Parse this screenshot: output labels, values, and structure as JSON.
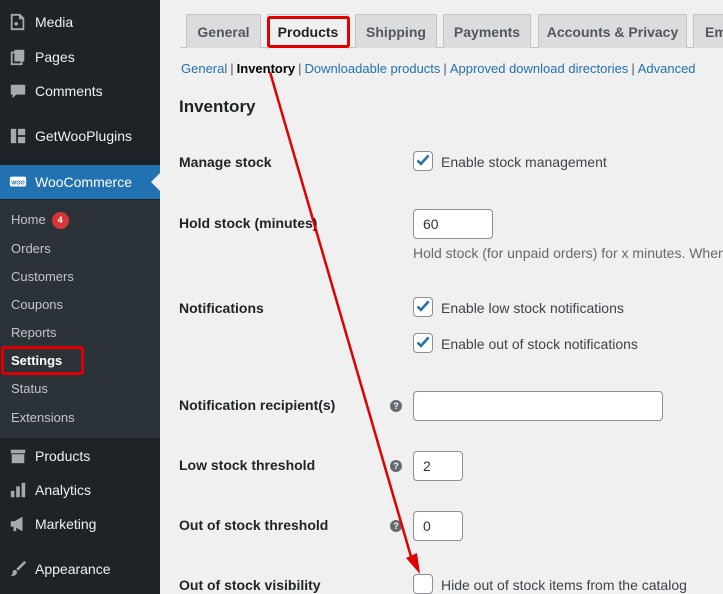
{
  "sidebar": {
    "items": [
      {
        "label": "Media",
        "icon": "media-icon"
      },
      {
        "label": "Pages",
        "icon": "pages-icon"
      },
      {
        "label": "Comments",
        "icon": "comments-icon"
      },
      {
        "label": "GetWooPlugins",
        "icon": "plugin-icon"
      },
      {
        "label": "WooCommerce",
        "icon": "woo-icon"
      },
      {
        "label": "Products",
        "icon": "archive-icon"
      },
      {
        "label": "Analytics",
        "icon": "chart-icon"
      },
      {
        "label": "Marketing",
        "icon": "megaphone-icon"
      },
      {
        "label": "Appearance",
        "icon": "brush-icon"
      }
    ],
    "woo_badge": "WOO",
    "submenu": [
      {
        "label": "Home",
        "badge": "4"
      },
      {
        "label": "Orders"
      },
      {
        "label": "Customers"
      },
      {
        "label": "Coupons"
      },
      {
        "label": "Reports"
      },
      {
        "label": "Settings"
      },
      {
        "label": "Status"
      },
      {
        "label": "Extensions"
      }
    ]
  },
  "tabs": [
    "General",
    "Products",
    "Shipping",
    "Payments",
    "Accounts & Privacy",
    "Em"
  ],
  "subnav": [
    "General",
    "Inventory",
    "Downloadable products",
    "Approved download directories",
    "Advanced"
  ],
  "section_title": "Inventory",
  "fields": {
    "manage_stock": {
      "label": "Manage stock",
      "checkbox": "Enable stock management",
      "checked": true
    },
    "hold_stock": {
      "label": "Hold stock (minutes)",
      "value": "60",
      "desc": "Hold stock (for unpaid orders) for x minutes. When"
    },
    "notifications": {
      "label": "Notifications",
      "low": "Enable low stock notifications",
      "out": "Enable out of stock notifications"
    },
    "recipient": {
      "label": "Notification recipient(s)",
      "value": ""
    },
    "low_threshold": {
      "label": "Low stock threshold",
      "value": "2"
    },
    "out_threshold": {
      "label": "Out of stock threshold",
      "value": "0"
    },
    "visibility": {
      "label": "Out of stock visibility",
      "checkbox": "Hide out of stock items from the catalog",
      "checked": false
    }
  },
  "help_glyph": "?",
  "colors": {
    "accent": "#2271b1",
    "annotation": "#e00000",
    "sidebar": "#1d2327"
  }
}
